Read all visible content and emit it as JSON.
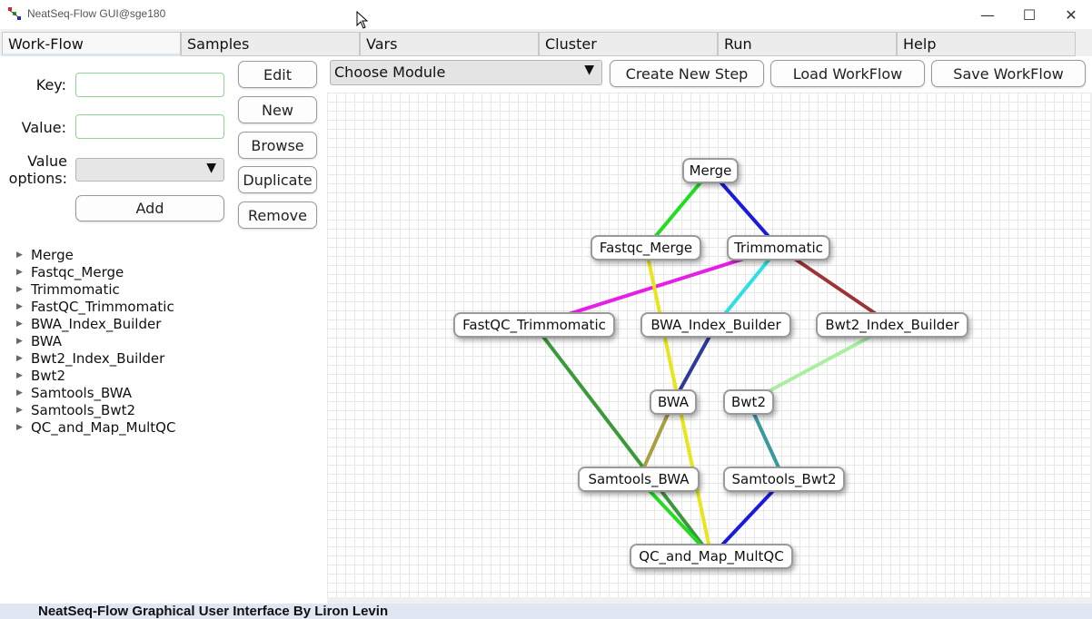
{
  "window": {
    "title": "NeatSeq-Flow GUI@sge180",
    "min_glyph": "—",
    "max_glyph": "☐",
    "close_glyph": "✕"
  },
  "tabs": [
    {
      "label": "Work-Flow",
      "active": true
    },
    {
      "label": "Samples"
    },
    {
      "label": "Vars"
    },
    {
      "label": "Cluster"
    },
    {
      "label": "Run"
    },
    {
      "label": "Help"
    }
  ],
  "left_panel": {
    "key_label": "Key:",
    "key_value": "",
    "value_label": "Value:",
    "value_value": "",
    "value_options_label_1": "Value",
    "value_options_label_2": "options:",
    "value_options_selected": "",
    "add_button": "Add",
    "buttons": {
      "edit": "Edit",
      "new": "New",
      "browse": "Browse",
      "duplicate": "Duplicate",
      "remove": "Remove"
    },
    "tree": [
      "Merge",
      "Fastqc_Merge",
      "Trimmomatic",
      "FastQC_Trimmomatic",
      "BWA_Index_Builder",
      "BWA",
      "Bwt2_Index_Builder",
      "Bwt2",
      "Samtools_BWA",
      "Samtools_Bwt2",
      "QC_and_Map_MultQC"
    ],
    "tree_glyph": "▶"
  },
  "toolbar": {
    "module_combo": "Choose Module",
    "combo_arrow": "▼",
    "create_step": "Create New Step",
    "load_workflow": "Load WorkFlow",
    "save_workflow": "Save WorkFlow"
  },
  "graph": {
    "nodes": [
      {
        "id": "Merge",
        "label": "Merge"
      },
      {
        "id": "Fastqc_Merge",
        "label": "Fastqc_Merge"
      },
      {
        "id": "Trimmomatic",
        "label": "Trimmomatic"
      },
      {
        "id": "FastQC_Trimmomatic",
        "label": "FastQC_Trimmomatic"
      },
      {
        "id": "BWA_Index_Builder",
        "label": "BWA_Index_Builder"
      },
      {
        "id": "Bwt2_Index_Builder",
        "label": "Bwt2_Index_Builder"
      },
      {
        "id": "BWA",
        "label": "BWA"
      },
      {
        "id": "Bwt2",
        "label": "Bwt2"
      },
      {
        "id": "Samtools_BWA",
        "label": "Samtools_BWA"
      },
      {
        "id": "Samtools_Bwt2",
        "label": "Samtools_Bwt2"
      },
      {
        "id": "QC_and_Map_MultQC",
        "label": "QC_and_Map_MultQC"
      }
    ],
    "edges": [
      {
        "from": "Merge",
        "to": "Fastqc_Merge",
        "color": "#22dd22"
      },
      {
        "from": "Merge",
        "to": "Trimmomatic",
        "color": "#1a1adc"
      },
      {
        "from": "Trimmomatic",
        "to": "FastQC_Trimmomatic",
        "color": "#e61ee6"
      },
      {
        "from": "Trimmomatic",
        "to": "BWA_Index_Builder",
        "color": "#2ee0e6"
      },
      {
        "from": "Trimmomatic",
        "to": "Bwt2_Index_Builder",
        "color": "#9b3535"
      },
      {
        "from": "Fastqc_Merge",
        "to": "QC_and_Map_MultQC",
        "color": "#e8e61a"
      },
      {
        "from": "FastQC_Trimmomatic",
        "to": "QC_and_Map_MultQC",
        "color": "#3a9a3a"
      },
      {
        "from": "BWA_Index_Builder",
        "to": "BWA",
        "color": "#2c3a9c"
      },
      {
        "from": "Bwt2_Index_Builder",
        "to": "Bwt2",
        "color": "#a8f0a0"
      },
      {
        "from": "BWA",
        "to": "Samtools_BWA",
        "color": "#a8a040"
      },
      {
        "from": "Bwt2",
        "to": "Samtools_Bwt2",
        "color": "#3a98a0"
      },
      {
        "from": "Samtools_BWA",
        "to": "QC_and_Map_MultQC",
        "color": "#22dd22"
      },
      {
        "from": "Samtools_Bwt2",
        "to": "QC_and_Map_MultQC",
        "color": "#1a1adc"
      }
    ]
  },
  "status": "NeatSeq-Flow Graphical User Interface By Liron Levin"
}
